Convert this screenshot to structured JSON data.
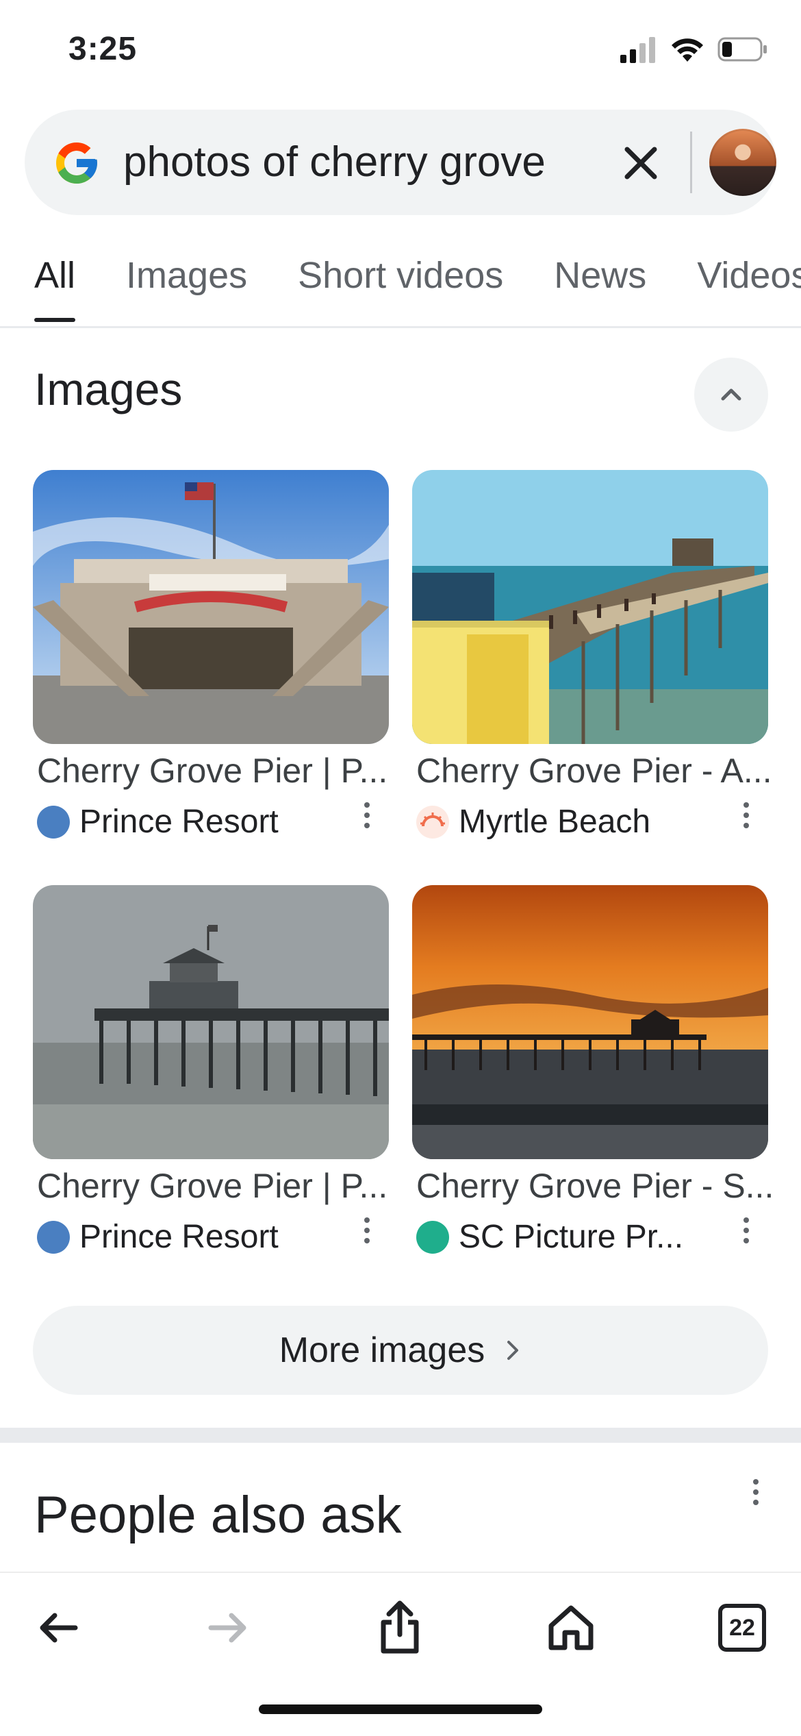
{
  "status_bar": {
    "time": "3:25"
  },
  "search": {
    "query": "photos of cherry grove",
    "clear_icon": "close-icon",
    "logo_icon": "google-g-icon"
  },
  "tabs": [
    {
      "label": "All",
      "active": true
    },
    {
      "label": "Images",
      "active": false
    },
    {
      "label": "Short videos",
      "active": false
    },
    {
      "label": "News",
      "active": false
    },
    {
      "label": "Videos",
      "active": false
    }
  ],
  "images_section": {
    "title": "Images",
    "collapse_icon": "chevron-up-icon",
    "results": [
      {
        "caption": "Cherry Grove Pier | P...",
        "source": "Prince Resort",
        "source_color": "#4a7fc1"
      },
      {
        "caption": "Cherry Grove Pier - A...",
        "source": "Myrtle Beach",
        "source_color": "#f06d4c"
      },
      {
        "caption": "Cherry Grove Pier | P...",
        "source": "Prince Resort",
        "source_color": "#4a7fc1"
      },
      {
        "caption": "Cherry Grove Pier - S...",
        "source": "SC Picture Pr...",
        "source_color": "#1fae8c"
      }
    ],
    "more_button": "More images"
  },
  "people_also_ask": {
    "title": "People also ask"
  },
  "toolbar": {
    "tab_count": "22"
  }
}
